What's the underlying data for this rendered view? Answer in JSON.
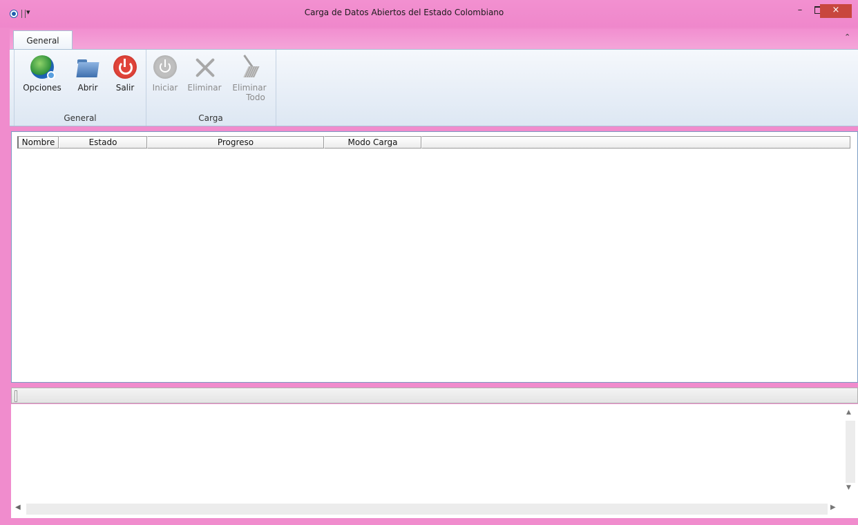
{
  "window": {
    "title": "Carga de Datos Abiertos del Estado Colombiano",
    "qat_dropdown_icon": "qat-dropdown-icon",
    "controls": {
      "minimize": "–",
      "maximize_icon": "maximize-icon",
      "close": "×"
    },
    "accent_color": "#f08ccd"
  },
  "ribbon": {
    "tabs": [
      {
        "label": "General",
        "active": true
      }
    ],
    "groups": {
      "general": {
        "label": "General",
        "buttons": {
          "opciones": {
            "label": "Opciones",
            "icon": "globe-settings-icon",
            "enabled": true
          },
          "abrir": {
            "label": "Abrir",
            "icon": "folder-open-icon",
            "enabled": true
          },
          "salir": {
            "label": "Salir",
            "icon": "power-icon",
            "enabled": true
          }
        }
      },
      "carga": {
        "label": "Carga",
        "buttons": {
          "iniciar": {
            "label": "Iniciar",
            "icon": "power-start-icon",
            "enabled": false
          },
          "eliminar": {
            "label": "Eliminar",
            "icon": "delete-x-icon",
            "enabled": false
          },
          "eliminar_todo": {
            "label_line1": "Eliminar",
            "label_line2": "Todo",
            "icon": "broom-icon",
            "enabled": false
          }
        }
      }
    }
  },
  "listview": {
    "columns": [
      "Nombre",
      "Estado",
      "Progreso",
      "Modo Carga",
      ""
    ],
    "rows": []
  },
  "log": {
    "lines": []
  }
}
